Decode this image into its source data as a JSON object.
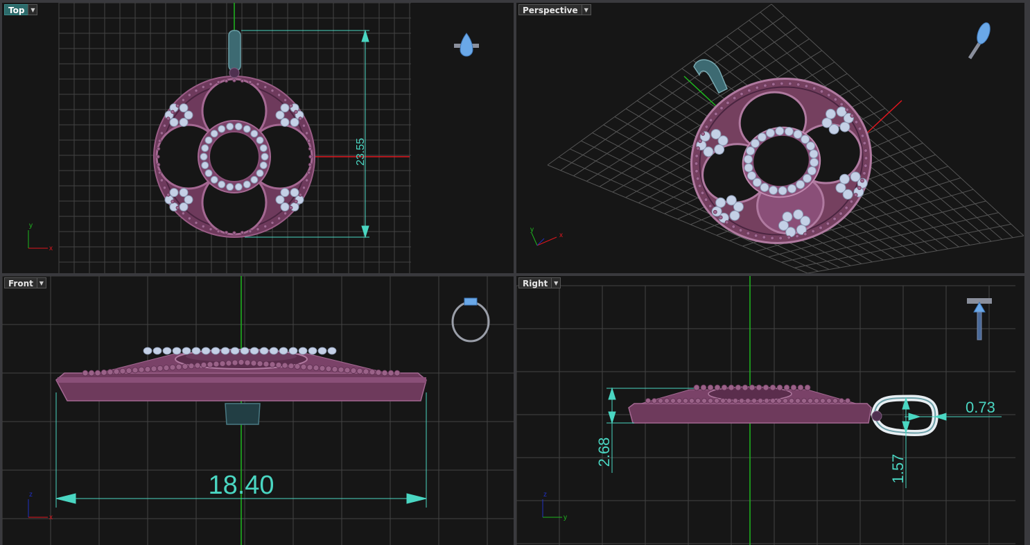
{
  "viewports": {
    "top": {
      "label": "Top",
      "active": true
    },
    "perspective": {
      "label": "Perspective",
      "active": false
    },
    "front": {
      "label": "Front",
      "active": false
    },
    "right": {
      "label": "Right",
      "active": false
    }
  },
  "dimensions": {
    "top_height": "23.55",
    "front_width": "18.40",
    "right_thickness": "2.68",
    "right_bail_width": "0.73",
    "right_bail_depth": "1.57"
  },
  "axes": {
    "x": "x",
    "y": "y",
    "z": "z"
  },
  "colors": {
    "background": "#161616",
    "grid": "#4a4a4a",
    "x_axis": "#e0161e",
    "y_axis": "#1fb81f",
    "dimension": "#4ad6c2",
    "metal": "#7a3f64",
    "stone": "#c4d0e6",
    "bail": "#3d6a72",
    "gizmo": "#6aa8e8"
  },
  "icons": {
    "navigation_gizmo": "ring-preview-icon",
    "dropdown": "chevron-down-icon"
  }
}
